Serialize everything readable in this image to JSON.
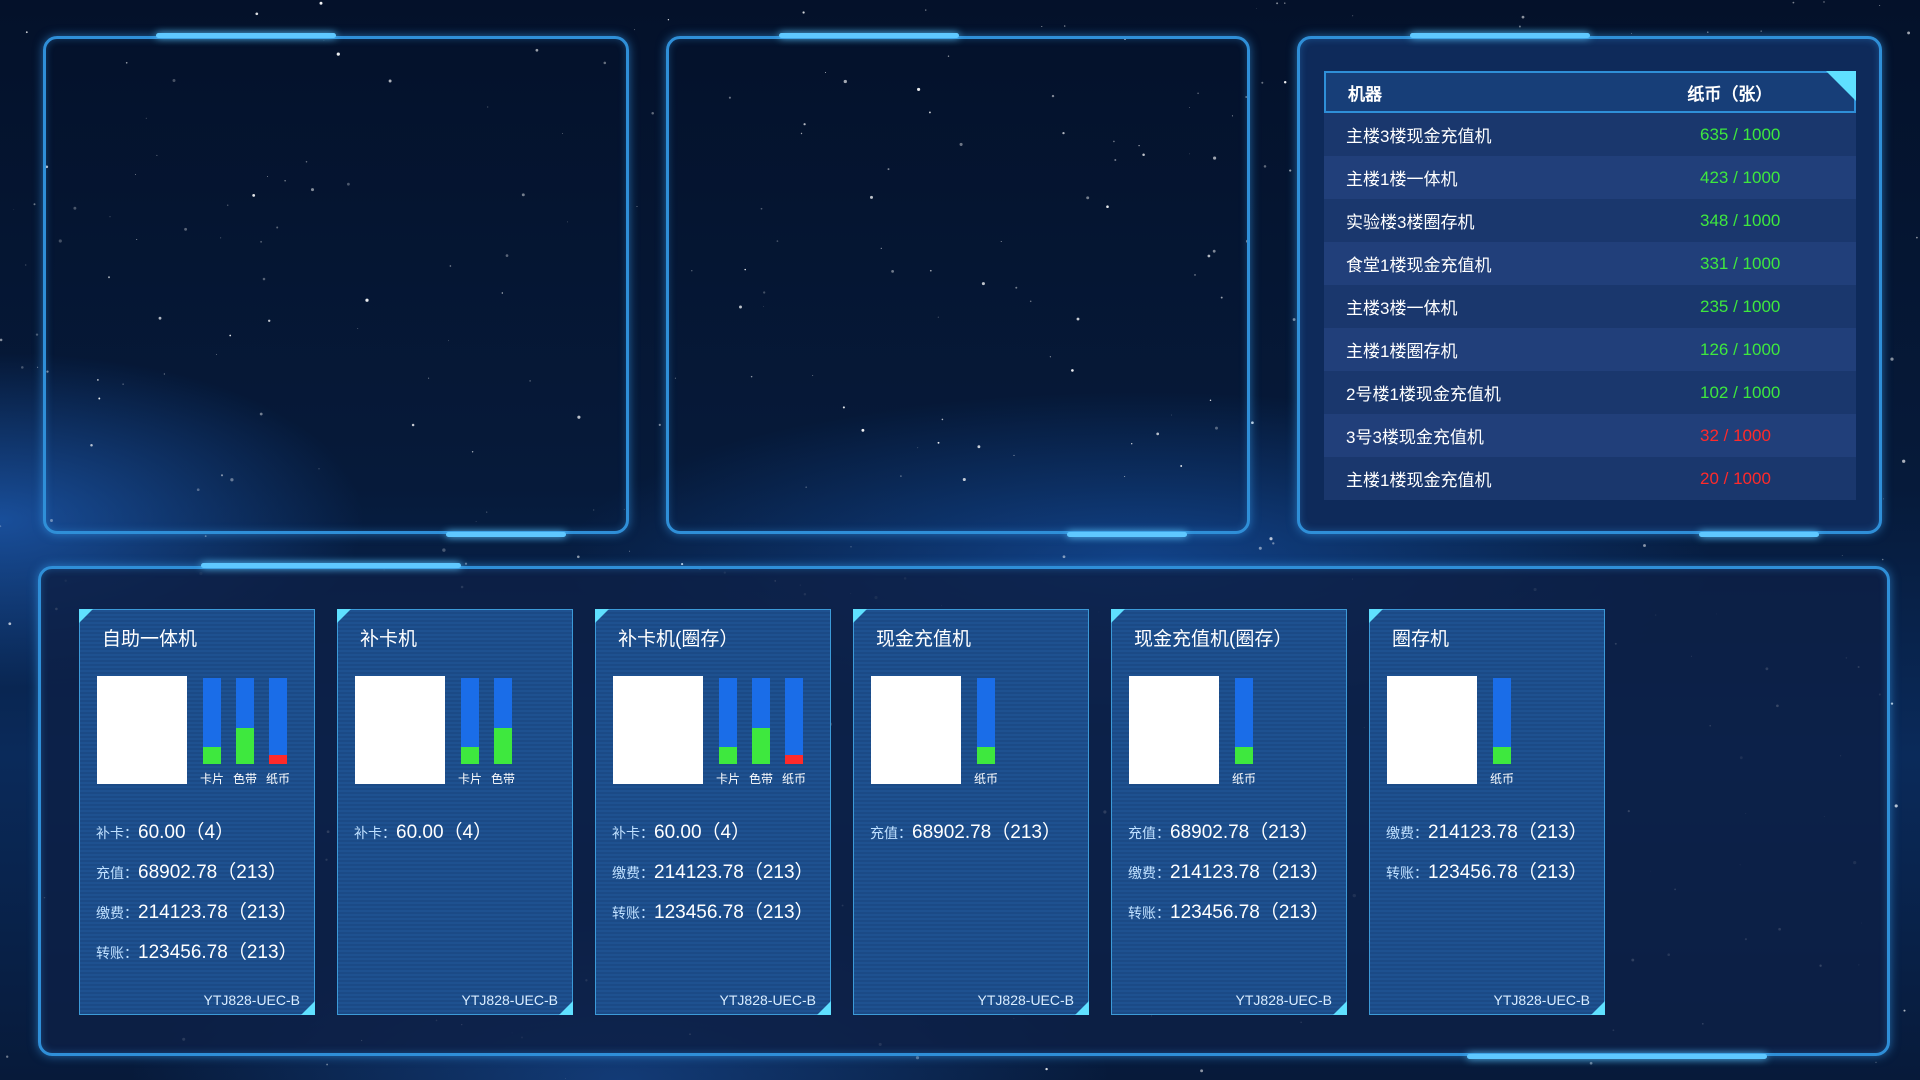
{
  "table": {
    "header": {
      "machine": "机器",
      "paper": "纸币（张）"
    },
    "rows": [
      {
        "machine": "主楼3楼现金充值机",
        "paper": "635 / 1000",
        "status": "ok"
      },
      {
        "machine": "主楼1楼一体机",
        "paper": "423 / 1000",
        "status": "ok"
      },
      {
        "machine": "实验楼3楼圈存机",
        "paper": "348 / 1000",
        "status": "ok"
      },
      {
        "machine": "食堂1楼现金充值机",
        "paper": "331 / 1000",
        "status": "ok"
      },
      {
        "machine": "主楼3楼一体机",
        "paper": "235 / 1000",
        "status": "ok"
      },
      {
        "machine": "主楼1楼圈存机",
        "paper": "126 / 1000",
        "status": "ok"
      },
      {
        "machine": "2号楼1楼现金充值机",
        "paper": "102 / 1000",
        "status": "ok"
      },
      {
        "machine": "3号3楼现金充值机",
        "paper": "32 / 1000",
        "status": "low"
      },
      {
        "machine": "主楼1楼现金充值机",
        "paper": "20 / 1000",
        "status": "low"
      }
    ]
  },
  "colors": {
    "ok": "#3ee83e",
    "low": "#ff2a2a",
    "bar_bg": "#1a6de8",
    "accent": "#5fe0ff"
  },
  "cards": [
    {
      "title": "自助一体机",
      "bars": [
        {
          "label": "卡片",
          "level": 0.2,
          "status": "ok"
        },
        {
          "label": "色带",
          "level": 0.42,
          "status": "ok"
        },
        {
          "label": "纸币",
          "level": 0.1,
          "status": "low"
        }
      ],
      "stats": [
        {
          "key": "补卡：",
          "value": "60.00（4）"
        },
        {
          "key": "充值：",
          "value": "68902.78（213）"
        },
        {
          "key": "缴费：",
          "value": "214123.78（213）"
        },
        {
          "key": "转账：",
          "value": "123456.78（213）"
        }
      ],
      "code": "YTJ828-UEC-B"
    },
    {
      "title": "补卡机",
      "bars": [
        {
          "label": "卡片",
          "level": 0.2,
          "status": "ok"
        },
        {
          "label": "色带",
          "level": 0.42,
          "status": "ok"
        }
      ],
      "stats": [
        {
          "key": "补卡：",
          "value": "60.00（4）"
        }
      ],
      "code": "YTJ828-UEC-B"
    },
    {
      "title": "补卡机(圈存）",
      "bars": [
        {
          "label": "卡片",
          "level": 0.2,
          "status": "ok"
        },
        {
          "label": "色带",
          "level": 0.42,
          "status": "ok"
        },
        {
          "label": "纸币",
          "level": 0.1,
          "status": "low"
        }
      ],
      "stats": [
        {
          "key": "补卡：",
          "value": "60.00（4）"
        },
        {
          "key": "缴费：",
          "value": "214123.78（213）"
        },
        {
          "key": "转账：",
          "value": "123456.78（213）"
        }
      ],
      "code": "YTJ828-UEC-B"
    },
    {
      "title": "现金充值机",
      "bars": [
        {
          "label": "纸币",
          "level": 0.2,
          "status": "ok"
        }
      ],
      "stats": [
        {
          "key": "充值：",
          "value": "68902.78（213）"
        }
      ],
      "code": "YTJ828-UEC-B"
    },
    {
      "title": "现金充值机(圈存）",
      "bars": [
        {
          "label": "纸币",
          "level": 0.2,
          "status": "ok"
        }
      ],
      "stats": [
        {
          "key": "充值：",
          "value": "68902.78（213）"
        },
        {
          "key": "缴费：",
          "value": "214123.78（213）"
        },
        {
          "key": "转账：",
          "value": "123456.78（213）"
        }
      ],
      "code": "YTJ828-UEC-B"
    },
    {
      "title": "圈存机",
      "bars": [
        {
          "label": "纸币",
          "level": 0.2,
          "status": "ok"
        }
      ],
      "stats": [
        {
          "key": "缴费：",
          "value": "214123.78（213）"
        },
        {
          "key": "转账：",
          "value": "123456.78（213）"
        }
      ],
      "code": "YTJ828-UEC-B"
    }
  ]
}
